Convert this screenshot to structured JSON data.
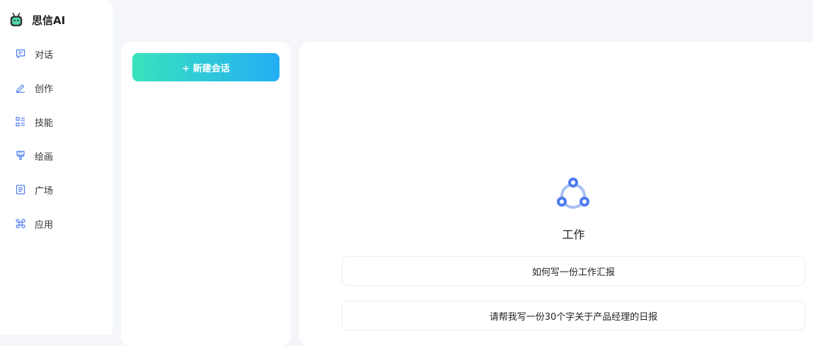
{
  "brand": {
    "name": "思信AI",
    "icon": "robot-icon"
  },
  "sidebar": {
    "items": [
      {
        "label": "对话",
        "icon": "chat-icon"
      },
      {
        "label": "创作",
        "icon": "pencil-icon"
      },
      {
        "label": "技能",
        "icon": "list-icon"
      },
      {
        "label": "绘画",
        "icon": "brush-icon"
      },
      {
        "label": "广场",
        "icon": "document-icon"
      },
      {
        "label": "应用",
        "icon": "command-icon"
      }
    ]
  },
  "conversations": {
    "new_button_label": "+ 新建会话"
  },
  "main": {
    "category_title": "工作",
    "category_icon": "share-nodes-icon",
    "suggestions": [
      "如何写一份工作汇报",
      "请帮我写一份30个字关于产品经理的日报"
    ]
  },
  "colors": {
    "accent_start": "#39e3bd",
    "accent_end": "#23aef5",
    "icon_blue": "#4d7cf0"
  }
}
